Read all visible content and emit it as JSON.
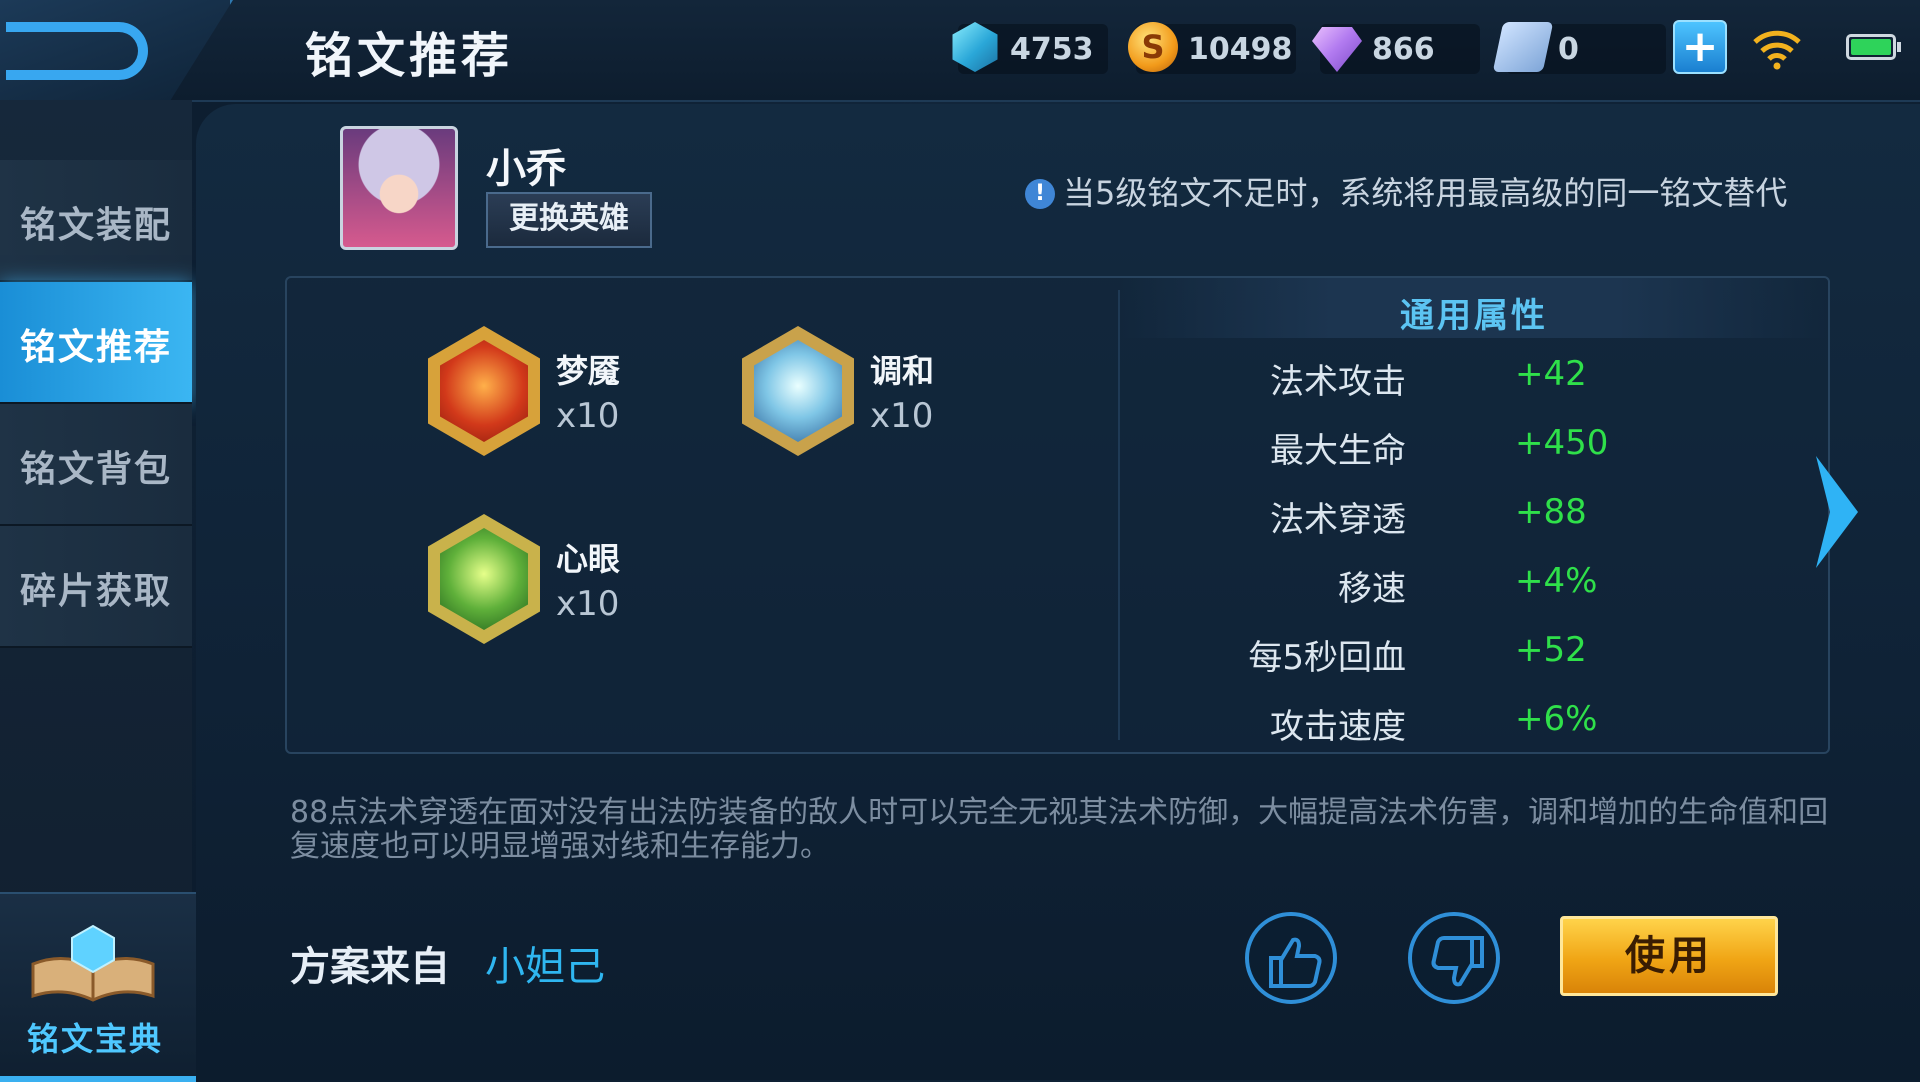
{
  "header": {
    "title": "铭文推荐",
    "resources": [
      {
        "icon": "crystal-icon",
        "value": "4753"
      },
      {
        "icon": "gold-coin-icon",
        "value": "10498"
      },
      {
        "icon": "diamond-icon",
        "value": "866"
      },
      {
        "icon": "ticket-icon",
        "value": "0"
      }
    ],
    "plus_label": "+"
  },
  "sidebar": {
    "items": [
      {
        "label": "铭文装配",
        "active": false
      },
      {
        "label": "铭文推荐",
        "active": true
      },
      {
        "label": "铭文背包",
        "active": false
      },
      {
        "label": "碎片获取",
        "active": false
      }
    ],
    "codex_label": "铭文宝典"
  },
  "hero": {
    "name": "小乔",
    "change_label": "更换英雄"
  },
  "notice": "当5级铭文不足时，系统将用最高级的同一铭文替代",
  "runes": [
    {
      "name": "梦魇",
      "count": "x10",
      "color": "red"
    },
    {
      "name": "调和",
      "count": "x10",
      "color": "blue"
    },
    {
      "name": "心眼",
      "count": "x10",
      "color": "green"
    }
  ],
  "attributes": {
    "header": "通用属性",
    "rows": [
      {
        "label": "法术攻击",
        "value": "+42"
      },
      {
        "label": "最大生命",
        "value": "+450"
      },
      {
        "label": "法术穿透",
        "value": "+88"
      },
      {
        "label": "移速",
        "value": "+4%"
      },
      {
        "label": "每5秒回血",
        "value": "+52"
      },
      {
        "label": "攻击速度",
        "value": "+6%"
      }
    ]
  },
  "description": "88点法术穿透在面对没有出法防装备的敌人时可以完全无视其法术防御，大幅提高法术伤害，调和增加的生命值和回复速度也可以明显增强对线和生存能力。",
  "source": {
    "label": "方案来自",
    "author": "小妲己"
  },
  "use_label": "使用",
  "colors": {
    "accent": "#3bb6f2",
    "positive": "#2fe04a",
    "button_gold": "#f0a515"
  }
}
